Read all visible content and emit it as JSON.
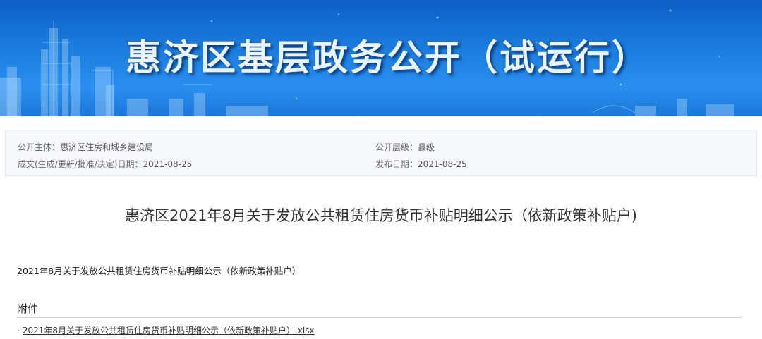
{
  "banner": {
    "title": "惠济区基层政务公开（试运行）"
  },
  "meta": {
    "publisher_label": "公开主体：",
    "publisher_value": "惠济区住房和城乡建设局",
    "level_label": "公开层级：",
    "level_value": "县级",
    "created_label": "成文(生成/更新/批准/决定)日期：",
    "created_value": "2021-08-25",
    "published_label": "发布日期：",
    "published_value": "2021-08-25"
  },
  "document": {
    "title": "惠济区2021年8月关于发放公共租赁住房货币补贴明细公示（依新政策补贴户)",
    "body": "2021年8月关于发放公共租赁住房货币补贴明细公示（依新政策补贴户）"
  },
  "attachments": {
    "heading": "附件",
    "bullet": "·",
    "items": [
      {
        "label": "2021年8月关于发放公共租赁住房货币补贴明细公示（依新政策补贴户）.xlsx"
      }
    ]
  },
  "colors": {
    "banner_top": "#0d5fc4",
    "banner_bottom": "#2a8ff0",
    "meta_bg": "#f4f8fd"
  }
}
